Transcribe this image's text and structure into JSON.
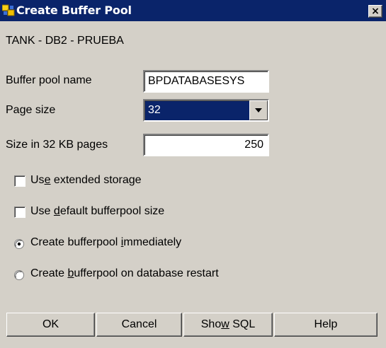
{
  "window": {
    "title": "Create Buffer Pool",
    "close_glyph": "×",
    "icon": "db2-buffer-pool-icon"
  },
  "context": "TANK - DB2 - PRUEBA",
  "form": {
    "buffer_pool_name": {
      "label": "Buffer pool name",
      "value": "BPDATABASESYS"
    },
    "page_size": {
      "label": "Page size",
      "value": "32"
    },
    "size_in_pages": {
      "label": "Size in 32 KB pages",
      "value": "250"
    }
  },
  "options": {
    "extended_storage": {
      "pre": "Us",
      "mnemonic": "e",
      "post": " extended storage",
      "checked": false
    },
    "default_size": {
      "pre": "Use ",
      "mnemonic": "d",
      "post": "efault bufferpool size",
      "checked": false
    },
    "create_immediately": {
      "pre": "Create bufferpool ",
      "mnemonic": "i",
      "post": "mmediately",
      "selected": true
    },
    "create_on_restart": {
      "pre": "Create ",
      "mnemonic": "b",
      "post": "ufferpool on database restart",
      "selected": false
    }
  },
  "buttons": {
    "ok": "OK",
    "cancel": "Cancel",
    "show_sql_pre": "Sho",
    "show_sql_mnemonic": "w",
    "show_sql_post": " SQL",
    "help": "Help"
  },
  "colors": {
    "titlebar": "#0a246a",
    "face": "#d4d0c8",
    "selection": "#0a246a"
  }
}
